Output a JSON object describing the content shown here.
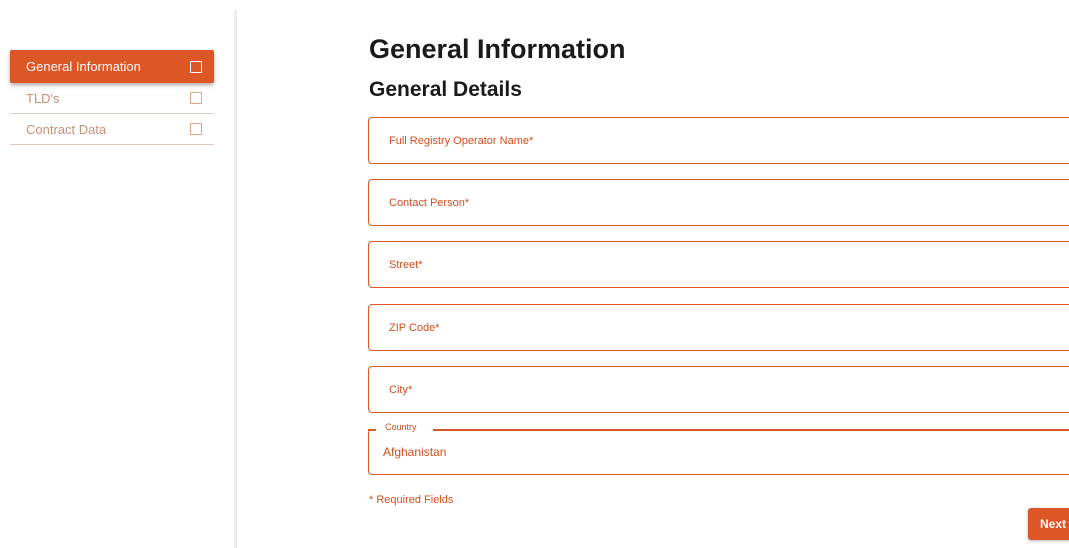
{
  "sidebar": {
    "items": [
      {
        "label": "General Information",
        "active": true
      },
      {
        "label": "TLD's",
        "active": false
      },
      {
        "label": "Contract Data",
        "active": false
      }
    ]
  },
  "main": {
    "title": "General Information",
    "section_title": "General Details",
    "fields": [
      {
        "placeholder": "Full Registry Operator Name*",
        "value": ""
      },
      {
        "placeholder": "Contact Person*",
        "value": ""
      },
      {
        "placeholder": "Street*",
        "value": ""
      },
      {
        "placeholder": "ZIP Code*",
        "value": ""
      },
      {
        "placeholder": "City*",
        "value": ""
      }
    ],
    "country": {
      "label": "Country",
      "value": "Afghanistan"
    },
    "required_note": "* Required Fields",
    "next_label": "Next"
  },
  "colors": {
    "accent": "#dd5726",
    "text_accent": "#cf4f1e",
    "muted": "#c4917c"
  }
}
